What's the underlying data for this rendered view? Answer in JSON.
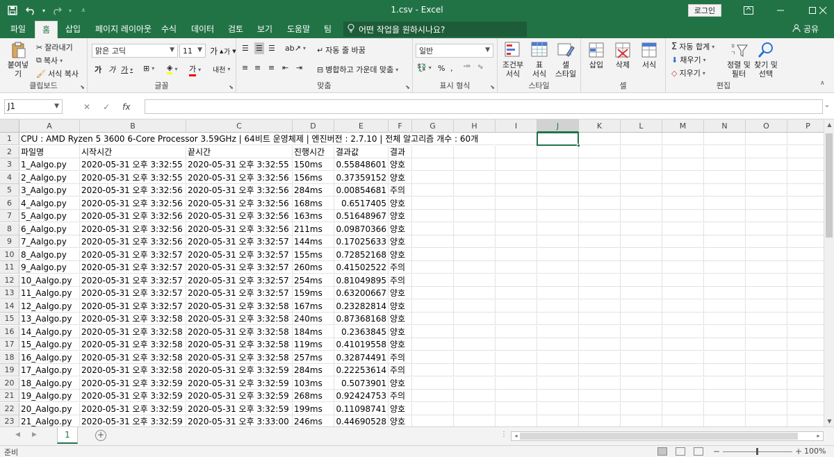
{
  "window": {
    "title": "1.csv  -  Excel",
    "login_label": "로그인",
    "minimize_icon": "minimize-icon",
    "restore_icon": "ribbon-display-icon"
  },
  "tabs": [
    {
      "label": "파일"
    },
    {
      "label": "홈"
    },
    {
      "label": "삽입"
    },
    {
      "label": "페이지 레이아웃"
    },
    {
      "label": "수식"
    },
    {
      "label": "데이터"
    },
    {
      "label": "검토"
    },
    {
      "label": "보기"
    },
    {
      "label": "도움말"
    },
    {
      "label": "팀"
    }
  ],
  "tell_me": "어떤 작업을 원하시나요?",
  "share_label": "공유",
  "ribbon": {
    "clipboard": {
      "paste": "붙여넣기",
      "cut": "잘라내기",
      "copy": "복사",
      "format_painter": "서식 복사",
      "label": "클립보드"
    },
    "font": {
      "font_name": "맑은 고딕",
      "font_size": "11",
      "label": "글꼴",
      "grow": "가",
      "shrink": "가",
      "bold": "가",
      "italic": "가",
      "underline": "가",
      "font_color": "가",
      "phonetic": "내천"
    },
    "alignment": {
      "wrap_text": "자동 줄 바꿈",
      "merge_center": "병합하고 가운데 맞춤",
      "label": "맞춤"
    },
    "number": {
      "format": "일반",
      "label": "표시 형식",
      "percent": "%",
      "comma": ","
    },
    "styles": {
      "conditional": "조건부\n서식",
      "table": "표\n서식",
      "cell_styles": "셀\n스타일",
      "label": "스타일"
    },
    "cells": {
      "insert": "삽입",
      "delete": "삭제",
      "format": "서식",
      "label": "셀"
    },
    "editing": {
      "autosum": "자동 합계",
      "fill": "채우기",
      "clear": "지우기",
      "sort_filter": "정렬 및\n필터",
      "find_select": "찾기 및\n선택",
      "label": "편집"
    }
  },
  "formula_bar": {
    "name_box": "J1",
    "fx": "fx",
    "content": ""
  },
  "columns": [
    "A",
    "B",
    "C",
    "D",
    "E",
    "F",
    "G",
    "H",
    "I",
    "J",
    "K",
    "L",
    "M",
    "N",
    "O",
    "P"
  ],
  "selected_cell": "J1",
  "row1_text": "CPU : AMD Ryzen 5 3600 6-Core Processor 3.59GHz | 64비트 운영체제 | 엔진버전 : 2.7.10 | 전체 알고리즘 개수 : 60개",
  "headers": [
    "파일명",
    "시작시간",
    "끝시간",
    "진행시간",
    "결과값",
    "결과"
  ],
  "rows": [
    [
      "1_Aalgo.py",
      "2020-05-31 오후 3:32:55",
      "2020-05-31 오후 3:32:55",
      "150ms",
      "0.55848601",
      "양호"
    ],
    [
      "2_Aalgo.py",
      "2020-05-31 오후 3:32:55",
      "2020-05-31 오후 3:32:56",
      "156ms",
      "0.37359152",
      "양호"
    ],
    [
      "3_Aalgo.py",
      "2020-05-31 오후 3:32:56",
      "2020-05-31 오후 3:32:56",
      "284ms",
      "0.00854681",
      "주의"
    ],
    [
      "4_Aalgo.py",
      "2020-05-31 오후 3:32:56",
      "2020-05-31 오후 3:32:56",
      "168ms",
      "0.6517405",
      "양호"
    ],
    [
      "5_Aalgo.py",
      "2020-05-31 오후 3:32:56",
      "2020-05-31 오후 3:32:56",
      "163ms",
      "0.51648967",
      "양호"
    ],
    [
      "6_Aalgo.py",
      "2020-05-31 오후 3:32:56",
      "2020-05-31 오후 3:32:56",
      "211ms",
      "0.09870366",
      "양호"
    ],
    [
      "7_Aalgo.py",
      "2020-05-31 오후 3:32:56",
      "2020-05-31 오후 3:32:57",
      "144ms",
      "0.17025633",
      "양호"
    ],
    [
      "8_Aalgo.py",
      "2020-05-31 오후 3:32:57",
      "2020-05-31 오후 3:32:57",
      "155ms",
      "0.72852168",
      "양호"
    ],
    [
      "9_Aalgo.py",
      "2020-05-31 오후 3:32:57",
      "2020-05-31 오후 3:32:57",
      "260ms",
      "0.41502522",
      "주의"
    ],
    [
      "10_Aalgo.py",
      "2020-05-31 오후 3:32:57",
      "2020-05-31 오후 3:32:57",
      "254ms",
      "0.81049895",
      "주의"
    ],
    [
      "11_Aalgo.py",
      "2020-05-31 오후 3:32:57",
      "2020-05-31 오후 3:32:57",
      "159ms",
      "0.63200667",
      "양호"
    ],
    [
      "12_Aalgo.py",
      "2020-05-31 오후 3:32:57",
      "2020-05-31 오후 3:32:58",
      "167ms",
      "0.23282814",
      "양호"
    ],
    [
      "13_Aalgo.py",
      "2020-05-31 오후 3:32:58",
      "2020-05-31 오후 3:32:58",
      "240ms",
      "0.87368168",
      "양호"
    ],
    [
      "14_Aalgo.py",
      "2020-05-31 오후 3:32:58",
      "2020-05-31 오후 3:32:58",
      "184ms",
      "0.2363845",
      "양호"
    ],
    [
      "15_Aalgo.py",
      "2020-05-31 오후 3:32:58",
      "2020-05-31 오후 3:32:58",
      "119ms",
      "0.41019558",
      "양호"
    ],
    [
      "16_Aalgo.py",
      "2020-05-31 오후 3:32:58",
      "2020-05-31 오후 3:32:58",
      "257ms",
      "0.32874491",
      "주의"
    ],
    [
      "17_Aalgo.py",
      "2020-05-31 오후 3:32:58",
      "2020-05-31 오후 3:32:59",
      "284ms",
      "0.22253614",
      "주의"
    ],
    [
      "18_Aalgo.py",
      "2020-05-31 오후 3:32:59",
      "2020-05-31 오후 3:32:59",
      "103ms",
      "0.5073901",
      "양호"
    ],
    [
      "19_Aalgo.py",
      "2020-05-31 오후 3:32:59",
      "2020-05-31 오후 3:32:59",
      "268ms",
      "0.92424753",
      "주의"
    ],
    [
      "20_Aalgo.py",
      "2020-05-31 오후 3:32:59",
      "2020-05-31 오후 3:32:59",
      "199ms",
      "0.11098741",
      "양호"
    ],
    [
      "21_Aalgo.py",
      "2020-05-31 오후 3:32:59",
      "2020-05-31 오후 3:33:00",
      "246ms",
      "0.44690528",
      "양호"
    ]
  ],
  "sheet_tab": "1",
  "status": {
    "ready": "준비",
    "zoom": "100%"
  },
  "colors": {
    "accent": "#217346",
    "ribbon_bg": "#f3f3f3"
  }
}
